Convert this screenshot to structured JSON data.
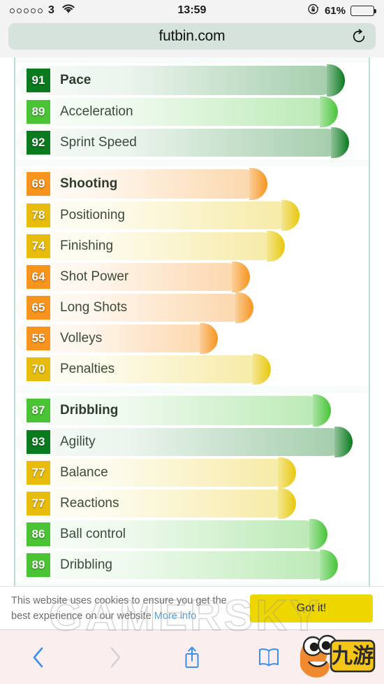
{
  "status_bar": {
    "signal_dots": 5,
    "carrier": "3",
    "wifi_icon": "wifi-icon",
    "time": "13:59",
    "rotation_lock_icon": "rotation-lock-icon",
    "battery_percent_label": "61%",
    "battery_level": 61
  },
  "browser": {
    "url": "futbin.com",
    "reload_icon": "reload-icon",
    "back_icon": "chevron-left-icon",
    "forward_icon": "chevron-right-icon",
    "share_icon": "share-icon",
    "bookmarks_icon": "book-icon"
  },
  "colors": {
    "badge_dark_green": "#0a7a1e",
    "badge_green": "#4ac434",
    "badge_gold": "#e8bc0c",
    "badge_orange": "#f7941e",
    "bar_green_dark": "#0a7a1e",
    "bar_green": "#46c436",
    "bar_gold": "#e8c80c",
    "bar_orange": "#f7941e",
    "page_border": "#b9ded2",
    "cookie_button": "#eed600",
    "cookie_link": "#5a9fd4",
    "toolbar_accent": "#3b8ef0"
  },
  "chart_data": {
    "type": "bar",
    "title": "Player Attributes",
    "xlabel": "",
    "ylabel": "",
    "ylim": [
      0,
      99
    ],
    "groups": [
      {
        "name": "Pace",
        "header": {
          "label": "Pace",
          "value": 91,
          "badge_color": "badge_dark_green",
          "bar_color": "bar_green_dark"
        },
        "items": [
          {
            "label": "Acceleration",
            "value": 89,
            "badge_color": "badge_green",
            "bar_color": "bar_green"
          },
          {
            "label": "Sprint Speed",
            "value": 92,
            "badge_color": "badge_dark_green",
            "bar_color": "bar_green_dark"
          }
        ]
      },
      {
        "name": "Shooting",
        "header": {
          "label": "Shooting",
          "value": 69,
          "badge_color": "badge_orange",
          "bar_color": "bar_orange"
        },
        "items": [
          {
            "label": "Positioning",
            "value": 78,
            "badge_color": "badge_gold",
            "bar_color": "bar_gold"
          },
          {
            "label": "Finishing",
            "value": 74,
            "badge_color": "badge_gold",
            "bar_color": "bar_gold"
          },
          {
            "label": "Shot Power",
            "value": 64,
            "badge_color": "badge_orange",
            "bar_color": "bar_orange"
          },
          {
            "label": "Long Shots",
            "value": 65,
            "badge_color": "badge_orange",
            "bar_color": "bar_orange"
          },
          {
            "label": "Volleys",
            "value": 55,
            "badge_color": "badge_orange",
            "bar_color": "bar_orange"
          },
          {
            "label": "Penalties",
            "value": 70,
            "badge_color": "badge_gold",
            "bar_color": "bar_gold"
          }
        ]
      },
      {
        "name": "Dribbling",
        "header": {
          "label": "Dribbling",
          "value": 87,
          "badge_color": "badge_green",
          "bar_color": "bar_green"
        },
        "items": [
          {
            "label": "Agility",
            "value": 93,
            "badge_color": "badge_dark_green",
            "bar_color": "bar_green_dark"
          },
          {
            "label": "Balance",
            "value": 77,
            "badge_color": "badge_gold",
            "bar_color": "bar_gold"
          },
          {
            "label": "Reactions",
            "value": 77,
            "badge_color": "badge_gold",
            "bar_color": "bar_gold"
          },
          {
            "label": "Ball control",
            "value": 86,
            "badge_color": "badge_green",
            "bar_color": "bar_green"
          },
          {
            "label": "Dribbling",
            "value": 89,
            "badge_color": "badge_green",
            "bar_color": "bar_green"
          }
        ]
      }
    ]
  },
  "cookie_banner": {
    "message": "This website uses cookies to ensure you get the best experience on our website ",
    "link_label": "More info",
    "accept_label": "Got it!"
  },
  "watermark": {
    "text": "GAMERSKY",
    "logo_label": "九游"
  }
}
